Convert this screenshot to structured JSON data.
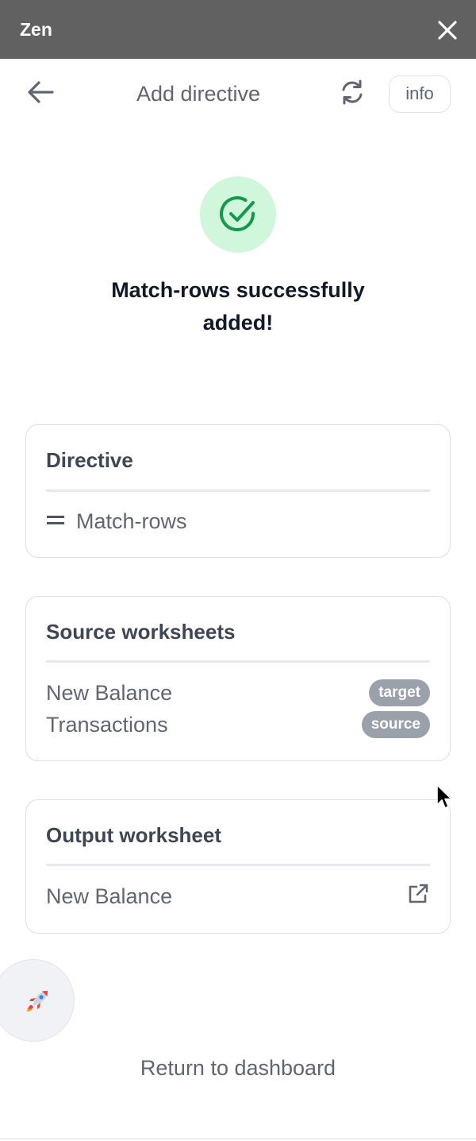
{
  "app": {
    "title": "Zen"
  },
  "header": {
    "title": "Add directive",
    "info_label": "info"
  },
  "success": {
    "message": "Match-rows successfully added!"
  },
  "directive_card": {
    "title": "Directive",
    "value": "Match-rows"
  },
  "source_card": {
    "title": "Source worksheets",
    "worksheets": [
      {
        "name": "New Balance",
        "role": "target"
      },
      {
        "name": "Transactions",
        "role": "source"
      }
    ]
  },
  "output_card": {
    "title": "Output worksheet",
    "name": "New Balance"
  },
  "footer": {
    "return_label": "Return to dashboard"
  },
  "icons": {
    "close": "close-icon",
    "back": "arrow-left-icon",
    "refresh": "refresh-icon",
    "success": "check-circle-icon",
    "equals": "equals-icon",
    "external": "external-link-icon",
    "launcher": "rocket-icon"
  },
  "colors": {
    "titlebar": "#616161",
    "success_bg": "#d0f7dc",
    "success_check": "#13994a",
    "badge": "#9aa1ab"
  }
}
